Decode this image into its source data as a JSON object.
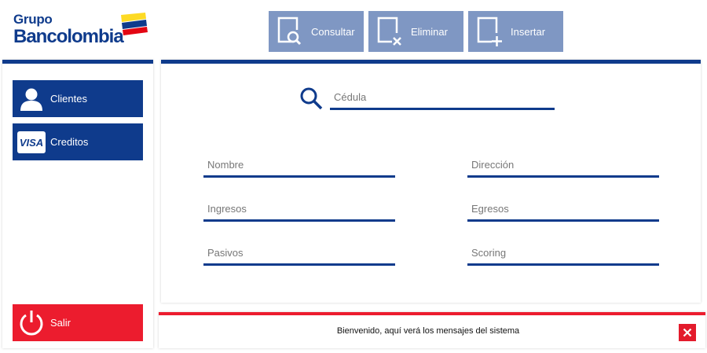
{
  "brand": {
    "logo_top": "Grupo",
    "logo_main": "Bancolombia",
    "colors": {
      "primary": "#0f3b8c",
      "toolbar": "#7f97c3",
      "danger": "#ec1c2e",
      "flag_yellow": "#fdda24",
      "flag_red": "#e30613"
    }
  },
  "toolbar": {
    "consultar": {
      "label": "Consultar",
      "icon": "document-search-icon"
    },
    "eliminar": {
      "label": "Eliminar",
      "icon": "document-delete-icon"
    },
    "insertar": {
      "label": "Insertar",
      "icon": "document-add-icon"
    }
  },
  "sidebar": {
    "clientes": {
      "label": "Clientes",
      "icon": "user-icon"
    },
    "creditos": {
      "label": "Creditos",
      "icon": "visa-card-icon",
      "icon_text": "VISA"
    },
    "salir": {
      "label": "Salir",
      "icon": "power-icon"
    }
  },
  "form": {
    "cedula": {
      "placeholder": "Cédula",
      "value": ""
    },
    "nombre": {
      "placeholder": "Nombre",
      "value": ""
    },
    "direccion": {
      "placeholder": "Dirección",
      "value": ""
    },
    "ingresos": {
      "placeholder": "Ingresos",
      "value": ""
    },
    "egresos": {
      "placeholder": "Egresos",
      "value": ""
    },
    "pasivos": {
      "placeholder": "Pasivos",
      "value": ""
    },
    "scoring": {
      "placeholder": "Scoring",
      "value": ""
    }
  },
  "messages": {
    "text": "Bienvenido, aquí verá los mensajes del sistema"
  }
}
